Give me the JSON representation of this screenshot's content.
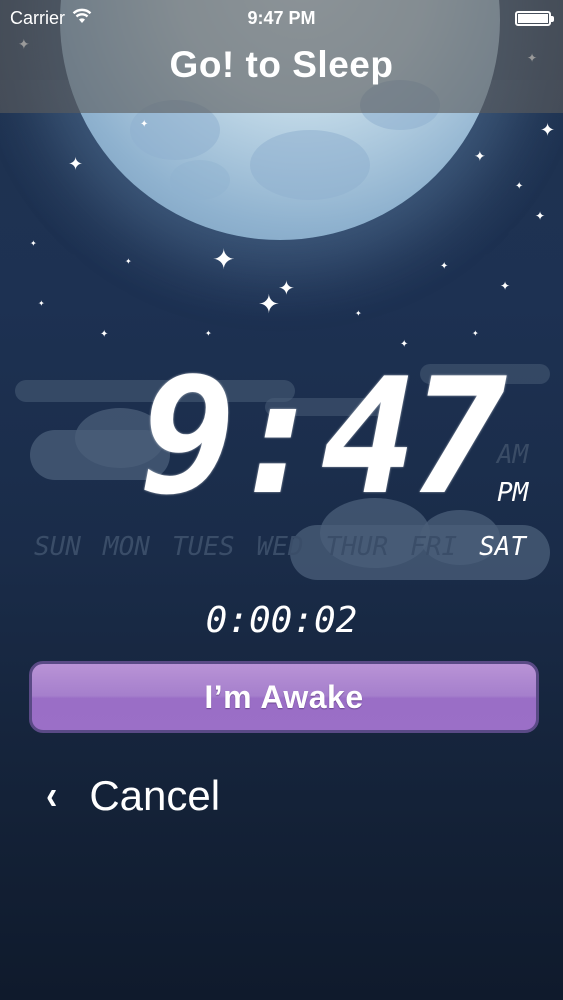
{
  "status_bar": {
    "carrier": "Carrier",
    "time": "9:47 PM",
    "wifi_icon": "wifi-icon",
    "battery_icon": "battery-icon",
    "battery_level": 1.0
  },
  "nav": {
    "title": "Go! to Sleep"
  },
  "clock": {
    "time": "9:47",
    "am_label": "AM",
    "pm_label": "PM",
    "active_period": "PM"
  },
  "days": [
    {
      "label": "SUN",
      "active": false
    },
    {
      "label": "MON",
      "active": false
    },
    {
      "label": "TUES",
      "active": false
    },
    {
      "label": "WED",
      "active": false
    },
    {
      "label": "THUR",
      "active": false
    },
    {
      "label": "FRI",
      "active": false
    },
    {
      "label": "SAT",
      "active": true
    }
  ],
  "elapsed": "0:00:02",
  "awake_button": {
    "label": "I’m Awake"
  },
  "cancel": {
    "label": "Cancel",
    "icon": "chevron-left-icon"
  },
  "colors": {
    "background": "#1d3152",
    "button": "#a57fcc",
    "button_border": "#5a4a86",
    "inactive_day": "#3a4d68"
  }
}
